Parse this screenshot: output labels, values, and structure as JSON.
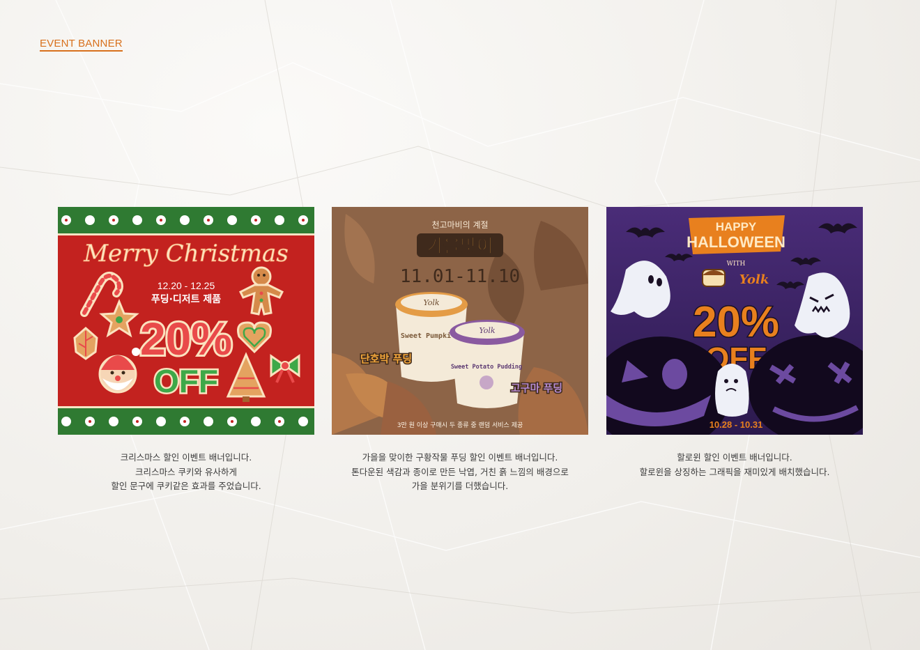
{
  "section_title": "EVENT BANNER",
  "colors": {
    "accent": "#d8701c",
    "christmas_red": "#c3221f",
    "autumn_brown": "#8d6447",
    "halloween_purple": "#3d2466",
    "halloween_orange": "#e8801e"
  },
  "banners": [
    {
      "headline": "Merry Christmas",
      "date": "12.20 - 12.25",
      "subtitle": "푸딩·디저트 제품",
      "discount": "20%",
      "off": "OFF",
      "caption": [
        "크리스마스 할인 이벤트 배너입니다.",
        "크리스마스 쿠키와 유사하게",
        "할인 문구에 쿠키같은 효과를 주었습니다."
      ]
    },
    {
      "kicker": "천고마비의 계절",
      "headline": "가을맞이",
      "date": "11.01-11.10",
      "product_brand": "Yolk",
      "product_left_name": "Sweet Pumpkin",
      "product_right_name": "Sweet Potato Pudding",
      "label_left": "단호박 푸딩",
      "label_right": "고구마 푸딩",
      "footer": "3만 원 이상 구매시 두 종류 중 랜덤 서비스 제공",
      "caption": [
        "가을을 맞이한 구황작물 푸딩 할인 이벤트 배너입니다.",
        "톤다운된 색감과 종이로 만든 낙엽, 거친 흙 느낌의 배경으로",
        "가을 분위기를 더했습니다."
      ]
    },
    {
      "headline_top": "HAPPY",
      "headline_bottom": "HALLOWEEN",
      "with": "WITH",
      "brand": "Yolk",
      "discount": "20%",
      "off": "OFF",
      "date": "10.28 - 10.31",
      "caption": [
        "할로윈 할인 이벤트 배너입니다.",
        "할로윈을 상징하는 그래픽을 재미있게 배치했습니다."
      ]
    }
  ]
}
